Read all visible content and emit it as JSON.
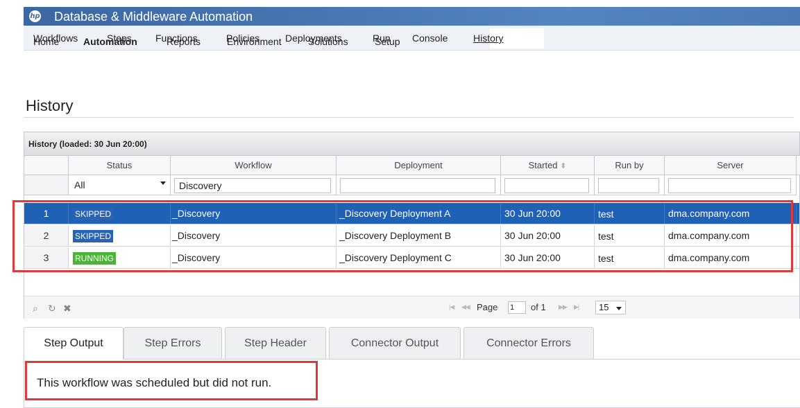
{
  "app": {
    "title": "Database & Middleware Automation",
    "logo_text": "hp"
  },
  "main_nav": [
    "Home",
    "Automation",
    "Reports",
    "Environment",
    "Solutions",
    "Setup"
  ],
  "main_nav_active": "Automation",
  "sub_nav": [
    "Workflows",
    "Steps",
    "Functions",
    "Policies",
    "Deployments",
    "Run",
    "Console",
    "History"
  ],
  "sub_nav_active": "History",
  "page": {
    "title": "History"
  },
  "grid": {
    "caption": "History (loaded: 30 Jun 20:00)",
    "columns": [
      "Status",
      "Workflow",
      "Deployment",
      "Started",
      "Run by",
      "Server"
    ],
    "sort_indicator": "⬍",
    "filters": {
      "status": "All",
      "workflow": "Discovery",
      "deployment": "",
      "started": "",
      "run_by": "",
      "server": ""
    },
    "rows": [
      {
        "num": "1",
        "status": "SKIPPED",
        "workflow": "_Discovery",
        "deployment": "_Discovery Deployment A",
        "started": "30 Jun 20:00",
        "run_by": "test",
        "server": "dma.company.com"
      },
      {
        "num": "2",
        "status": "SKIPPED",
        "workflow": "_Discovery",
        "deployment": "_Discovery Deployment B",
        "started": "30 Jun 20:00",
        "run_by": "test",
        "server": "dma.company.com"
      },
      {
        "num": "3",
        "status": "RUNNING",
        "workflow": "_Discovery",
        "deployment": "_Discovery Deployment C",
        "started": "30 Jun 20:00",
        "run_by": "test",
        "server": "dma.company.com"
      }
    ],
    "selected_row": 1
  },
  "pager": {
    "page_label": "Page",
    "page_value": "1",
    "of_label": "of 1",
    "page_size": "15"
  },
  "tabs": [
    "Step Output",
    "Step Errors",
    "Step Header",
    "Connector Output",
    "Connector Errors"
  ],
  "active_tab": "Step Output",
  "tab_content": "This workflow was scheduled but did not run.",
  "colors": {
    "title_bar": "#3b67a2",
    "selected_row": "#1f61b5",
    "skipped_badge": "#2a63b3",
    "running_badge": "#48b535",
    "highlight_box": "#e0393b"
  }
}
